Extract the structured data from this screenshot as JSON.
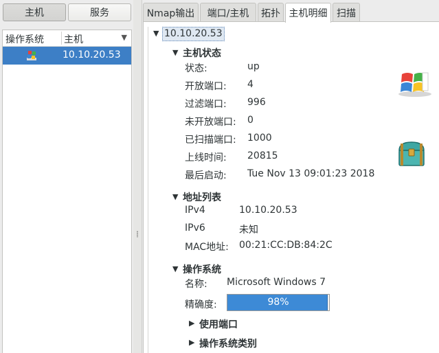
{
  "left_buttons": {
    "hosts": "主机",
    "services": "服务"
  },
  "host_list": {
    "columns": [
      "操作系统",
      "主机"
    ],
    "sort_indicator": "▼",
    "rows": [
      {
        "os_icon": "windows-os-icon",
        "host": "10.10.20.53"
      }
    ]
  },
  "tabs": [
    "Nmap输出",
    "端口/主机",
    "拓扑",
    "主机明细",
    "扫描"
  ],
  "active_tab": "主机明细",
  "detail": {
    "host": "10.10.20.53",
    "host_status": {
      "title": "主机状态",
      "fields": [
        {
          "label": "状态:",
          "value": "up"
        },
        {
          "label": "开放端口:",
          "value": "4"
        },
        {
          "label": "过滤端口:",
          "value": "996"
        },
        {
          "label": "未开放端口:",
          "value": "0"
        },
        {
          "label": "已扫描端口:",
          "value": "1000"
        },
        {
          "label": "上线时间:",
          "value": "20815"
        },
        {
          "label": "最后启动:",
          "value": "Tue Nov 13 09:01:23 2018"
        }
      ],
      "icons": [
        "windows-logo-icon",
        "treasure-chest-icon"
      ]
    },
    "addresses": {
      "title": "地址列表",
      "fields": [
        {
          "label": "IPv4",
          "value": "10.10.20.53"
        },
        {
          "label": "IPv6",
          "value": "未知"
        },
        {
          "label": "MAC地址:",
          "value": "00:21:CC:DB:84:2C"
        }
      ]
    },
    "os": {
      "title": "操作系统",
      "name_label": "名称:",
      "name_value": "Microsoft Windows 7",
      "accuracy_label": "精确度:",
      "accuracy_value": "98%",
      "accuracy_fraction": 0.98,
      "ports_used": "使用端口",
      "os_class": "操作系统类别"
    }
  },
  "colors": {
    "selection": "#3d7fc6",
    "progress": "#3d8ad6"
  }
}
